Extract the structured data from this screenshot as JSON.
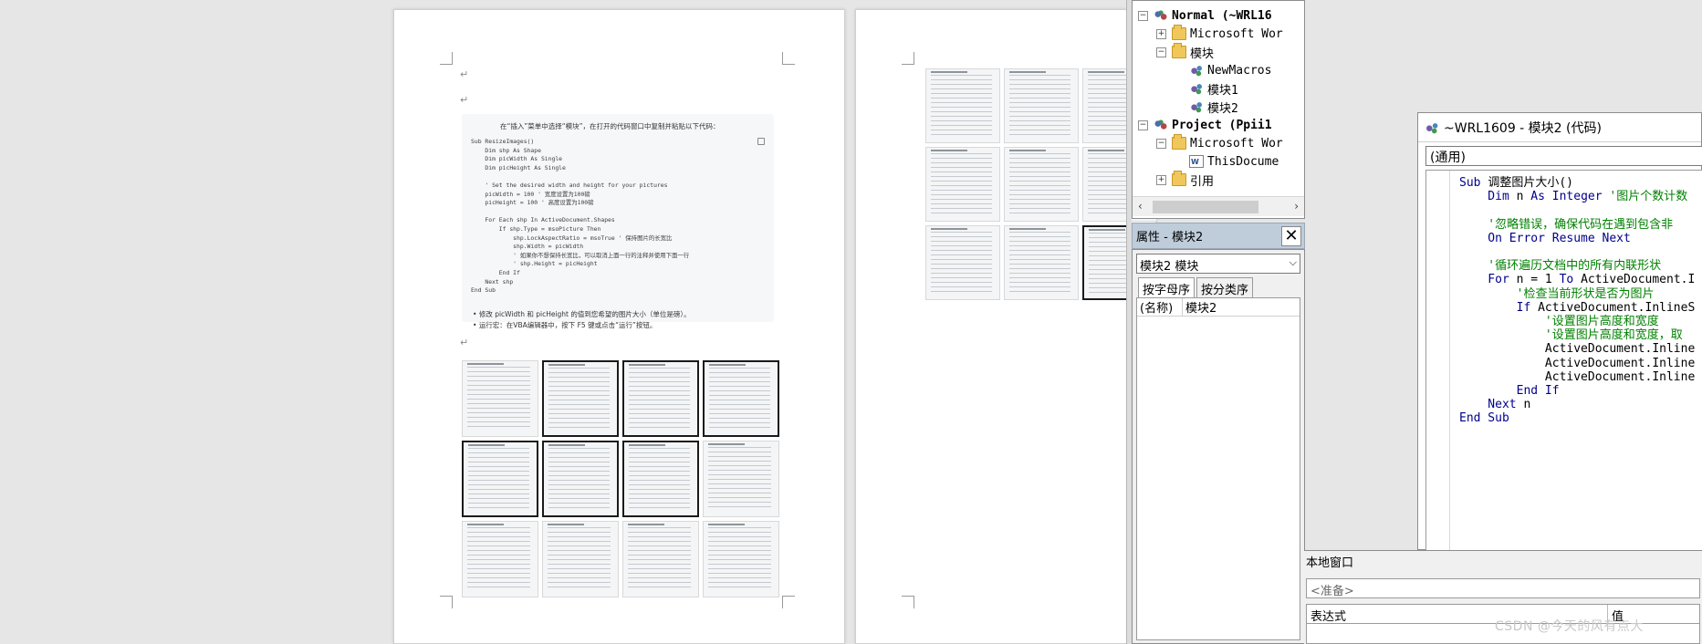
{
  "doc": {
    "para_mark": "↵",
    "intro_bullet": "在“插入”菜单中选择“模块”，在打开的代码窗口中复制并粘贴以下代码：",
    "code": "Sub ResizeImages()\n    Dim shp As Shape\n    Dim picWidth As Single\n    Dim picHeight As Single\n\n    ' Set the desired width and height for your pictures\n    picWidth = 100 ' 宽度设置为100磅\n    picHeight = 100 ' 高度设置为100磅\n\n    For Each shp In ActiveDocument.Shapes\n        If shp.Type = msoPicture Then\n            shp.LockAspectRatio = msoTrue ' 保持图片的长宽比\n            shp.Width = picWidth\n            ' 如果你不想保持长宽比，可以取消上面一行的注释并使用下面一行\n            ' shp.Height = picHeight\n        End If\n    Next shp\nEnd Sub",
    "bullets": [
      "修改 picWidth 和 picHeight 的值到您希望的图片大小（单位是磅）。",
      "运行宏：在VBA编辑器中，按下 F5 键或点击“运行”按钮。"
    ]
  },
  "project": {
    "tree": [
      {
        "label": "Normal (~WRL16",
        "bold": true,
        "expander": "−",
        "icon": "vba-project-icon"
      },
      {
        "label": "Microsoft Wor",
        "expander": "+",
        "icon": "folder-icon"
      },
      {
        "label": "模块",
        "expander": "−",
        "icon": "folder-icon"
      },
      {
        "label": "NewMacros",
        "icon": "module-icon"
      },
      {
        "label": "模块1",
        "icon": "module-icon"
      },
      {
        "label": "模块2",
        "icon": "module-icon"
      },
      {
        "label": "Project (Ppii1",
        "bold": true,
        "expander": "−",
        "icon": "vba-project-icon"
      },
      {
        "label": "Microsoft Wor",
        "expander": "−",
        "icon": "folder-icon"
      },
      {
        "label": "ThisDocume",
        "icon": "word-document-icon"
      },
      {
        "label": "引用",
        "expander": "+",
        "icon": "folder-icon"
      }
    ],
    "scroll_left": "‹",
    "scroll_right": "›"
  },
  "properties": {
    "title": "属性 - 模块2",
    "close": "✕",
    "object_combo": "模块2 模块",
    "combo_arrow": "⌵",
    "tab_alpha": "按字母序",
    "tab_category": "按分类序",
    "name_key": "(名称)",
    "name_value": "模块2"
  },
  "code_window": {
    "title": "~WRL1609 - 模块2 (代码)",
    "object_combo": "(通用)",
    "lines": [
      {
        "t": "kw",
        "s": "Sub "
      },
      {
        "t": "",
        "s": "调整图片大小()\n"
      },
      {
        "t": "kw",
        "s": "    Dim "
      },
      {
        "t": "",
        "s": "n "
      },
      {
        "t": "kw",
        "s": "As Integer "
      },
      {
        "t": "cm",
        "s": "'图片个数计数\n\n"
      },
      {
        "t": "cm",
        "s": "    '忽略错误，确保代码在遇到包含非\n"
      },
      {
        "t": "kw",
        "s": "    On Error Resume Next\n\n"
      },
      {
        "t": "cm",
        "s": "    '循环遍历文档中的所有内联形状\n"
      },
      {
        "t": "kw",
        "s": "    For "
      },
      {
        "t": "",
        "s": "n = 1 "
      },
      {
        "t": "kw",
        "s": "To "
      },
      {
        "t": "",
        "s": "ActiveDocument.I\n"
      },
      {
        "t": "cm",
        "s": "        '检查当前形状是否为图片\n"
      },
      {
        "t": "kw",
        "s": "        If "
      },
      {
        "t": "",
        "s": "ActiveDocument.InlineS\n"
      },
      {
        "t": "cm",
        "s": "            '设置图片高度和宽度\n"
      },
      {
        "t": "cm",
        "s": "            '设置图片高度和宽度，取\n"
      },
      {
        "t": "",
        "s": "            ActiveDocument.Inline\n"
      },
      {
        "t": "",
        "s": "            ActiveDocument.Inline\n"
      },
      {
        "t": "",
        "s": "            ActiveDocument.Inline\n"
      },
      {
        "t": "kw",
        "s": "        End If\n"
      },
      {
        "t": "kw",
        "s": "    Next "
      },
      {
        "t": "",
        "s": "n\n"
      },
      {
        "t": "kw",
        "s": "End Sub"
      }
    ]
  },
  "locals": {
    "title": "本地窗口",
    "state": "<准备>",
    "col_expr": "表达式",
    "col_value": "值"
  },
  "watermark": "CSDN @今天的风有点大"
}
